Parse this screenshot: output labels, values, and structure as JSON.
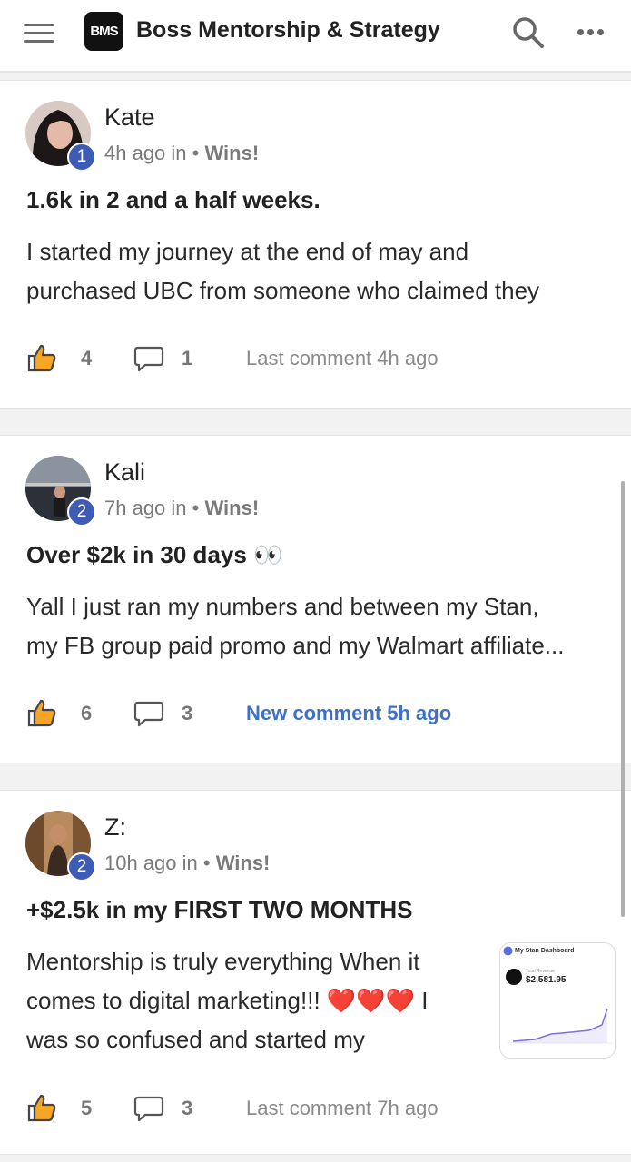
{
  "header": {
    "logo_text": "BMS",
    "title": "Boss Mentorship & Strategy",
    "icons": [
      "menu-icon",
      "search-icon",
      "more-icon"
    ]
  },
  "accent_color": "#3f5cb5",
  "link_color": "#3f6fc6",
  "posts": [
    {
      "author": "Kate",
      "level": "1",
      "time": "4h ago in •",
      "category": "Wins!",
      "title": "1.6k in 2 and a half weeks.",
      "body_lines": [
        "I started my journey at the end of may and",
        "purchased UBC from someone who claimed they"
      ],
      "likes": "4",
      "comments": "1",
      "last_comment": "Last comment 4h ago"
    },
    {
      "author": "Kali",
      "level": "2",
      "time": "7h ago in •",
      "category": "Wins!",
      "title": "Over $2k in 30 days 👀",
      "body_lines": [
        "Yall I just ran my numbers and between my Stan,",
        "my FB group paid promo and my Walmart affiliate..."
      ],
      "likes": "6",
      "comments": "3",
      "last_comment": "New comment 5h ago"
    },
    {
      "author": "Z:",
      "level": "2",
      "time": "10h ago in •",
      "category": "Wins!",
      "title": "+$2.5k in my FIRST TWO MONTHS",
      "body_lines": [
        "Mentorship is truly everything When it",
        "comes to digital marketing!!! ❤️❤️❤️ I",
        "was so confused and started my"
      ],
      "likes": "5",
      "comments": "3",
      "last_comment": "Last comment 7h ago",
      "thumbnail": {
        "title": "My Stan Dashboard",
        "label": "Total Revenue",
        "value": "$2,581.95"
      }
    }
  ]
}
